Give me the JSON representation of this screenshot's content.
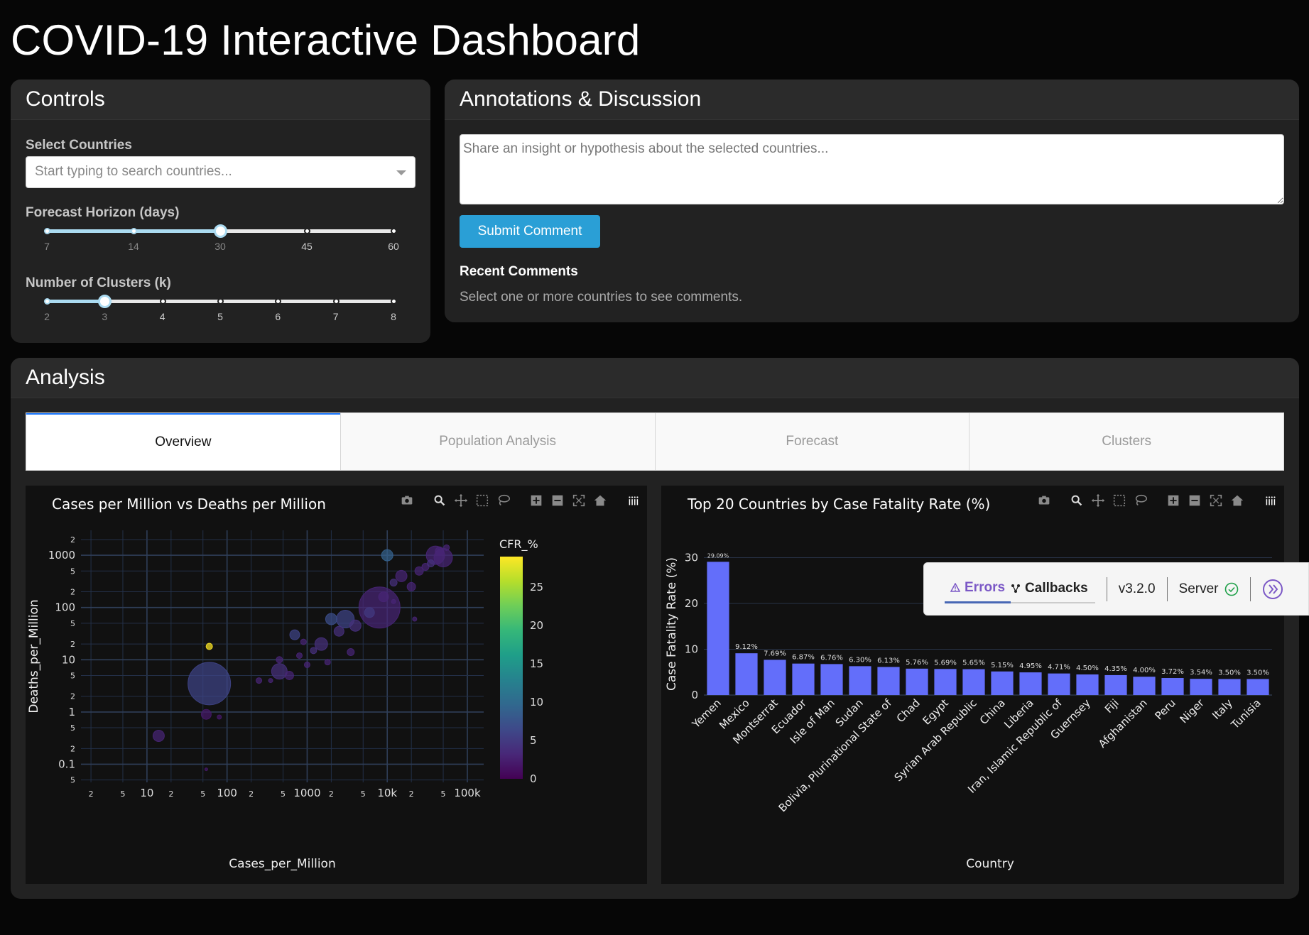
{
  "page_title": "COVID-19 Interactive Dashboard",
  "controls": {
    "header": "Controls",
    "select_label": "Select Countries",
    "select_placeholder": "Start typing to search countries...",
    "forecast_label": "Forecast Horizon (days)",
    "forecast_marks": [
      "7",
      "14",
      "30",
      "45",
      "60"
    ],
    "forecast_value": 30,
    "clusters_label": "Number of Clusters (k)",
    "cluster_marks": [
      "2",
      "3",
      "4",
      "5",
      "6",
      "7",
      "8"
    ],
    "clusters_value": 3
  },
  "annotations": {
    "header": "Annotations & Discussion",
    "placeholder": "Share an insight or hypothesis about the selected countries...",
    "submit_label": "Submit Comment",
    "recent_title": "Recent Comments",
    "recent_text": "Select one or more countries to see comments."
  },
  "analysis": {
    "header": "Analysis",
    "tabs": [
      {
        "label": "Overview",
        "active": true
      },
      {
        "label": "Population Analysis",
        "active": false
      },
      {
        "label": "Forecast",
        "active": false
      },
      {
        "label": "Clusters",
        "active": false
      }
    ]
  },
  "modebar_icons": [
    "camera-icon",
    "zoom-icon",
    "pan-icon",
    "box-select-icon",
    "lasso-icon",
    "zoom-in-icon",
    "zoom-out-icon",
    "autoscale-icon",
    "reset-axes-icon",
    "plotly-logo-icon"
  ],
  "devtools": {
    "errors_label": "Errors",
    "callbacks_label": "Callbacks",
    "version": "v3.2.0",
    "server_label": "Server"
  },
  "chart_data": [
    {
      "type": "scatter",
      "title": "Cases per Million vs Deaths per Million",
      "xlabel": "Cases_per_Million",
      "ylabel": "Deaths_per_Million",
      "xscale": "log",
      "yscale": "log",
      "xlim": [
        1.5,
        160000
      ],
      "ylim": [
        0.045,
        3000
      ],
      "x_ticks": [
        "2",
        "5",
        "10",
        "2",
        "5",
        "100",
        "2",
        "5",
        "1000",
        "2",
        "5",
        "10k",
        "2",
        "5",
        "100k"
      ],
      "y_ticks": [
        "5",
        "0.1",
        "2",
        "5",
        "1",
        "2",
        "5",
        "10",
        "2",
        "5",
        "100",
        "2",
        "5",
        "1000",
        "2"
      ],
      "colorbar": {
        "title": "CFR_%",
        "range": [
          0,
          29
        ],
        "ticks": [
          "0",
          "5",
          "10",
          "15",
          "20",
          "25"
        ],
        "colorscale": "viridis"
      },
      "points": [
        {
          "x": 14,
          "y": 0.35,
          "s": 16,
          "c": 3
        },
        {
          "x": 55,
          "y": 0.9,
          "s": 14,
          "c": 2
        },
        {
          "x": 60,
          "y": 3.5,
          "s": 60,
          "c": 6
        },
        {
          "x": 60,
          "y": 18,
          "s": 9,
          "c": 29
        },
        {
          "x": 80,
          "y": 0.8,
          "s": 6,
          "c": 2
        },
        {
          "x": 55,
          "y": 0.08,
          "s": 4,
          "c": 2
        },
        {
          "x": 250,
          "y": 4,
          "s": 8,
          "c": 3
        },
        {
          "x": 350,
          "y": 4,
          "s": 6,
          "c": 3
        },
        {
          "x": 450,
          "y": 6,
          "s": 22,
          "c": 4
        },
        {
          "x": 450,
          "y": 10,
          "s": 9,
          "c": 3
        },
        {
          "x": 600,
          "y": 5,
          "s": 12,
          "c": 3
        },
        {
          "x": 700,
          "y": 30,
          "s": 14,
          "c": 6
        },
        {
          "x": 800,
          "y": 12,
          "s": 8,
          "c": 3
        },
        {
          "x": 900,
          "y": 22,
          "s": 8,
          "c": 3
        },
        {
          "x": 1000,
          "y": 8,
          "s": 8,
          "c": 3
        },
        {
          "x": 1200,
          "y": 15,
          "s": 9,
          "c": 4
        },
        {
          "x": 1500,
          "y": 20,
          "s": 18,
          "c": 4
        },
        {
          "x": 1800,
          "y": 9,
          "s": 8,
          "c": 3
        },
        {
          "x": 2000,
          "y": 60,
          "s": 16,
          "c": 7
        },
        {
          "x": 2500,
          "y": 35,
          "s": 14,
          "c": 4
        },
        {
          "x": 3000,
          "y": 60,
          "s": 25,
          "c": 6
        },
        {
          "x": 3500,
          "y": 14,
          "s": 10,
          "c": 3
        },
        {
          "x": 4000,
          "y": 45,
          "s": 16,
          "c": 4
        },
        {
          "x": 6000,
          "y": 80,
          "s": 14,
          "c": 5
        },
        {
          "x": 8000,
          "y": 100,
          "s": 58,
          "c": 3
        },
        {
          "x": 9000,
          "y": 160,
          "s": 14,
          "c": 3
        },
        {
          "x": 10000,
          "y": 1000,
          "s": 16,
          "c": 9
        },
        {
          "x": 12000,
          "y": 300,
          "s": 10,
          "c": 4
        },
        {
          "x": 15000,
          "y": 400,
          "s": 16,
          "c": 3
        },
        {
          "x": 20000,
          "y": 250,
          "s": 12,
          "c": 3
        },
        {
          "x": 25000,
          "y": 500,
          "s": 12,
          "c": 3
        },
        {
          "x": 30000,
          "y": 600,
          "s": 10,
          "c": 3
        },
        {
          "x": 40000,
          "y": 1000,
          "s": 26,
          "c": 3
        },
        {
          "x": 50000,
          "y": 900,
          "s": 26,
          "c": 3
        },
        {
          "x": 45000,
          "y": 1200,
          "s": 12,
          "c": 3
        },
        {
          "x": 55000,
          "y": 1400,
          "s": 8,
          "c": 3
        },
        {
          "x": 35000,
          "y": 700,
          "s": 10,
          "c": 4
        },
        {
          "x": 22000,
          "y": 60,
          "s": 6,
          "c": 3
        },
        {
          "x": 12000,
          "y": 130,
          "s": 6,
          "c": 3
        }
      ]
    },
    {
      "type": "bar",
      "title": "Top 20 Countries by Case Fatality Rate (%)",
      "xlabel": "Country",
      "ylabel": "Case Fatality Rate (%)",
      "ylim": [
        0,
        31
      ],
      "y_ticks": [
        "0",
        "10",
        "20",
        "30"
      ],
      "categories": [
        "Yemen",
        "Mexico",
        "Montserrat",
        "Ecuador",
        "Isle of Man",
        "Sudan",
        "Bolivia, Plurinational State of",
        "Chad",
        "Egypt",
        "Syrian Arab Republic",
        "China",
        "Liberia",
        "Iran, Islamic Republic of",
        "Guernsey",
        "Fiji",
        "Afghanistan",
        "Peru",
        "Niger",
        "Italy",
        "Tunisia"
      ],
      "values": [
        29.09,
        9.12,
        7.69,
        6.87,
        6.76,
        6.3,
        6.13,
        5.76,
        5.69,
        5.65,
        5.15,
        4.95,
        4.71,
        4.5,
        4.35,
        4.0,
        3.72,
        3.54,
        3.5,
        3.5
      ],
      "value_labels": [
        "29.09%",
        "9.12%",
        "7.69%",
        "6.87%",
        "6.76%",
        "6.30%",
        "6.13%",
        "5.76%",
        "5.69%",
        "5.65%",
        "5.15%",
        "4.95%",
        "4.71%",
        "4.50%",
        "4.35%",
        "4.00%",
        "3.72%",
        "3.54%",
        "3.50%",
        "3.50%"
      ],
      "bar_color": "#636efa"
    }
  ]
}
